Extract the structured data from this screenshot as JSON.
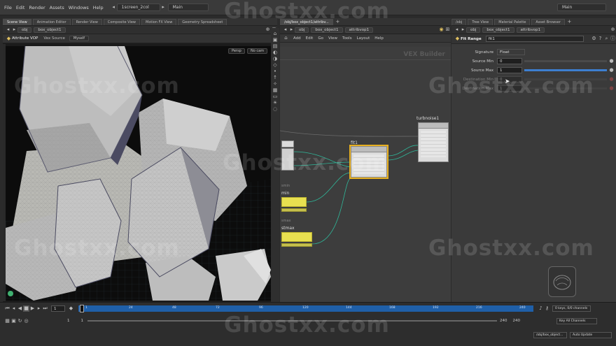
{
  "menubar": {
    "menus": [
      "File",
      "Edit",
      "Render",
      "Assets",
      "Windows",
      "Help"
    ],
    "desktop": "1screen_2col",
    "main": "Main",
    "right_main": "Main"
  },
  "scene": {
    "tabs": [
      "Scene View",
      "Animation Editor",
      "Render View",
      "Composite View",
      "Motion FX View",
      "Geometry Spreadsheet"
    ],
    "path": [
      "obj",
      "box_object1"
    ],
    "context": "Attribute VOP",
    "vex": "Vex Source",
    "myself": "Myself",
    "persp": "Persp",
    "cam": "No cam"
  },
  "network": {
    "tabs": [
      "/obj/box_object1/attribv..."
    ],
    "path": [
      "obj",
      "box_object1",
      "attribvop1"
    ],
    "menus": [
      "Add",
      "Edit",
      "Go",
      "View",
      "Tools",
      "Layout",
      "Help"
    ],
    "builder": "VEX Builder",
    "nodes": {
      "turbnoise": "turbnoise1",
      "fit": "fit1",
      "min": "min",
      "min_sub": "smin",
      "stmax": "stmax",
      "stmax_sub": "smax"
    }
  },
  "params": {
    "tabs": [
      "/obj",
      "Tree View",
      "Material Palette",
      "Asset Browser"
    ],
    "path": [
      "obj",
      "box_object1",
      "attribvop1"
    ],
    "node_type": "Fit Range",
    "node_name": "fit1",
    "rows": [
      {
        "label": "Signature",
        "value": "Float"
      },
      {
        "label": "Source Min",
        "value": "0"
      },
      {
        "label": "Source Max",
        "value": "1"
      },
      {
        "label": "Destination Min",
        "value": "0"
      },
      {
        "label": "Destination Max",
        "value": "1"
      }
    ]
  },
  "timeline": {
    "frame": "1",
    "ticks": [
      "1",
      "24",
      "48",
      "72",
      "96",
      "120",
      "144",
      "168",
      "192",
      "216",
      "240"
    ],
    "start": "1",
    "start2": "1",
    "end": "240",
    "end2": "240",
    "keys": "0 keys, 0/0 channels",
    "key_all": "Key All Channels",
    "path": "/obj/box_object...",
    "update": "Auto Update"
  },
  "watermark": "Ghostxx.com"
}
